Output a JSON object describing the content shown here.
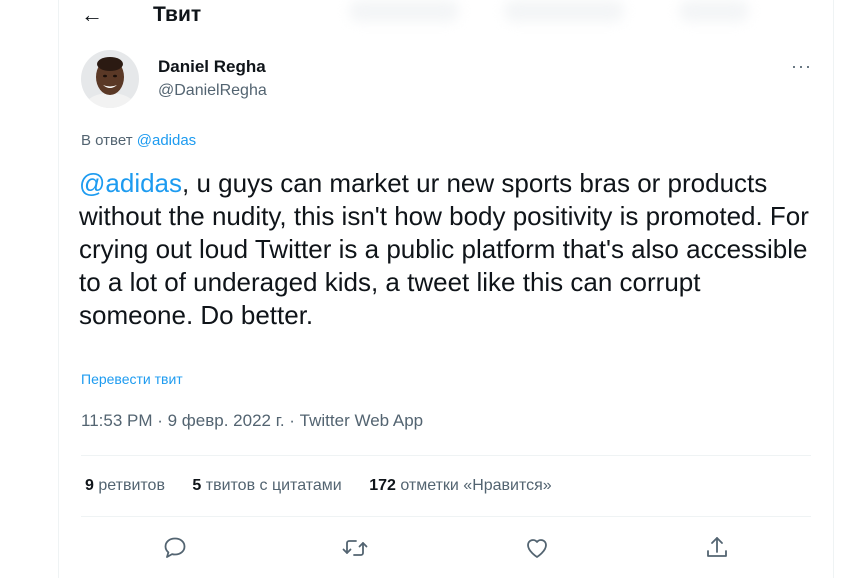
{
  "header": {
    "back_icon": "arrow-left-icon",
    "title": "Твит"
  },
  "tweet": {
    "author_name": "Daniel Regha",
    "author_handle": "@DanielRegha",
    "reply_prefix": "В ответ",
    "reply_mention": "@adidas",
    "text_mention": "@adidas",
    "text_body": ", u guys can market ur new sports bras or products without the nudity, this isn't how body positivity is promoted. For crying out loud Twitter is a public platform that's also accessible to a lot of underaged kids, a tweet like this can corrupt someone. Do better.",
    "translate_label": "Перевести твит",
    "timestamp": "11:53 PM · 9 февр. 2022 г. · ",
    "source": "Twitter Web App"
  },
  "stats": {
    "retweets_count": "9",
    "retweets_label": "ретвитов",
    "quotes_count": "5",
    "quotes_label": "твитов с цитатами",
    "likes_count": "172",
    "likes_label": "отметки «Нравится»"
  },
  "icons": [
    "arrow-left-icon",
    "more-icon",
    "reply-icon",
    "retweet-icon",
    "like-icon",
    "share-icon"
  ],
  "colors": {
    "accent": "#1d9bf0",
    "text": "#0f1419",
    "secondary": "#536471",
    "border": "#eff3f4"
  }
}
